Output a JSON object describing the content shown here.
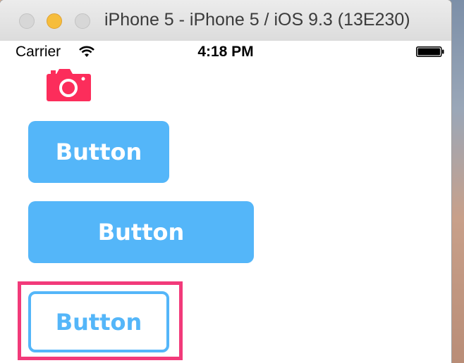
{
  "window": {
    "title": "iPhone 5 - iPhone 5 / iOS 9.3 (13E230)"
  },
  "status_bar": {
    "carrier": "Carrier",
    "time": "4:18 PM",
    "wifi_icon": "wifi-icon",
    "battery_icon": "battery-icon"
  },
  "content": {
    "camera_icon": "camera-icon",
    "camera_color": "#fc2d5b",
    "buttons": [
      {
        "label": "Button",
        "style": "filled",
        "color": "#54b6f9"
      },
      {
        "label": "Button",
        "style": "filled",
        "color": "#54b6f9"
      },
      {
        "label": "Button",
        "style": "outlined",
        "color": "#54b6f9",
        "highlight_color": "#f23a7a"
      }
    ]
  }
}
